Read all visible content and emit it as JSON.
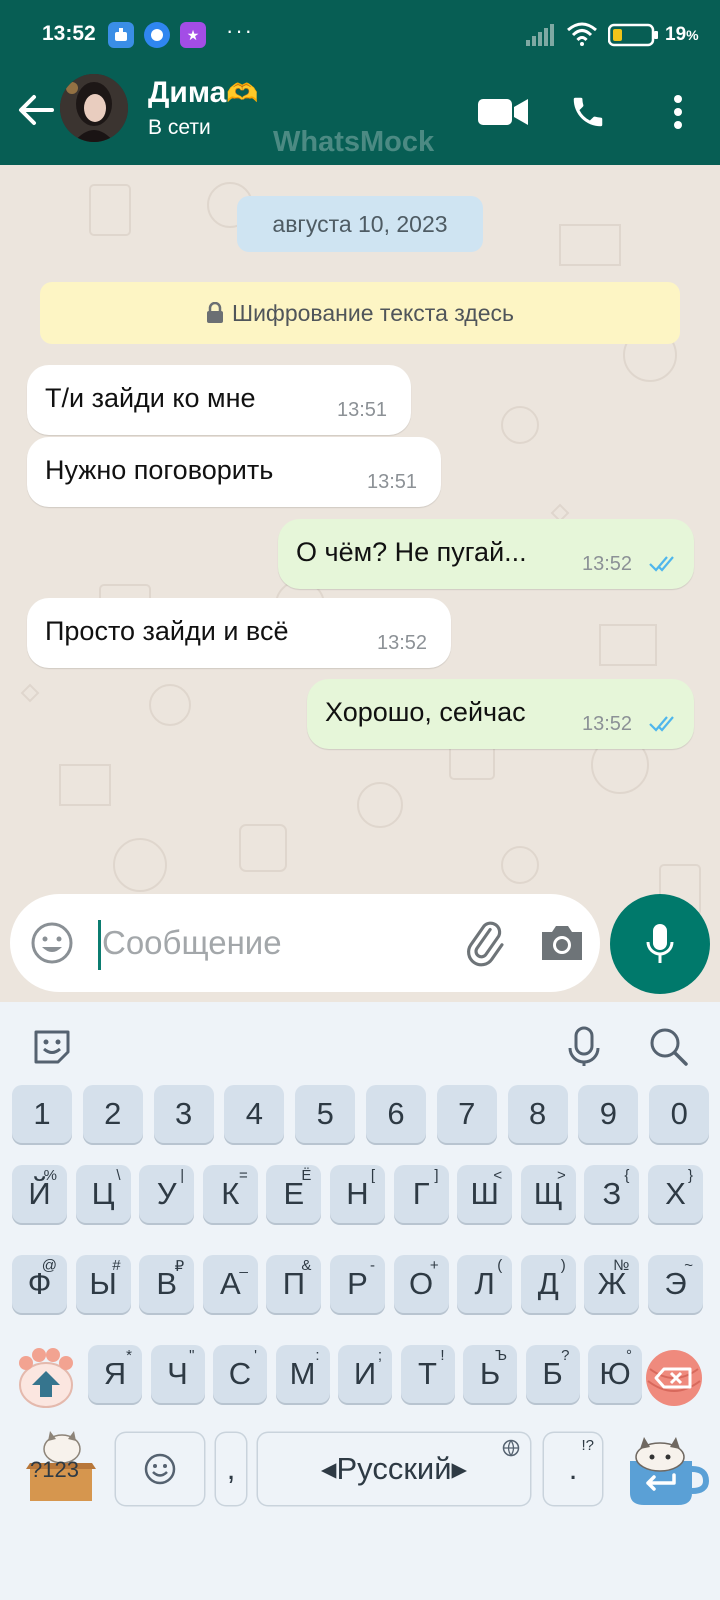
{
  "status_bar": {
    "time": "13:52",
    "dots": "···",
    "battery_percent": "19",
    "battery_percent_sign": "%"
  },
  "header": {
    "contact_name": "Дима",
    "contact_emoji": "🫶",
    "contact_status": "В сети",
    "watermark": "WhatsMock"
  },
  "chat": {
    "date_chip": "августа 10, 2023",
    "encryption_notice": "Шифрование текста здесь",
    "messages": [
      {
        "direction": "in",
        "text": "Т/и зайди ко мне",
        "time": "13:51"
      },
      {
        "direction": "in",
        "text": "Нужно поговорить",
        "time": "13:51"
      },
      {
        "direction": "out",
        "text": "О чём? Не пугай...",
        "time": "13:52",
        "read": true
      },
      {
        "direction": "in",
        "text": "Просто зайди и всё",
        "time": "13:52"
      },
      {
        "direction": "out",
        "text": "Хорошо, сейчас",
        "time": "13:52",
        "read": true
      }
    ]
  },
  "compose": {
    "placeholder": "Сообщение"
  },
  "keyboard": {
    "numbers": [
      "1",
      "2",
      "3",
      "4",
      "5",
      "6",
      "7",
      "8",
      "9",
      "0"
    ],
    "row1": [
      {
        "k": "Й",
        "s": "%"
      },
      {
        "k": "Ц",
        "s": "\\"
      },
      {
        "k": "У",
        "s": "|"
      },
      {
        "k": "К",
        "s": "="
      },
      {
        "k": "Е",
        "s": "Ё"
      },
      {
        "k": "Н",
        "s": "["
      },
      {
        "k": "Г",
        "s": "]"
      },
      {
        "k": "Ш",
        "s": "<"
      },
      {
        "k": "Щ",
        "s": ">"
      },
      {
        "k": "З",
        "s": "{"
      },
      {
        "k": "Х",
        "s": "}"
      }
    ],
    "row2": [
      {
        "k": "Ф",
        "s": "@"
      },
      {
        "k": "Ы",
        "s": "#"
      },
      {
        "k": "В",
        "s": "₽"
      },
      {
        "k": "А",
        "s": "_"
      },
      {
        "k": "П",
        "s": "&"
      },
      {
        "k": "Р",
        "s": "-"
      },
      {
        "k": "О",
        "s": "+"
      },
      {
        "k": "Л",
        "s": "("
      },
      {
        "k": "Д",
        "s": ")"
      },
      {
        "k": "Ж",
        "s": "№"
      },
      {
        "k": "Э",
        "s": "~"
      }
    ],
    "row3": [
      {
        "k": "Я",
        "s": "*"
      },
      {
        "k": "Ч",
        "s": "\""
      },
      {
        "k": "С",
        "s": "'"
      },
      {
        "k": "М",
        "s": ":"
      },
      {
        "k": "И",
        "s": ";"
      },
      {
        "k": "Т",
        "s": "!"
      },
      {
        "k": "Ь",
        "s": "Ъ"
      },
      {
        "k": "Б",
        "s": "?"
      },
      {
        "k": "Ю",
        "s": "°"
      }
    ],
    "numbers_key": "?123",
    "comma": ",",
    "space_label": "Русский",
    "space_left_arrow": "◂",
    "space_right_arrow": "▸",
    "period": ".",
    "period_sub": "!?",
    "accent_color": "#075e54"
  }
}
